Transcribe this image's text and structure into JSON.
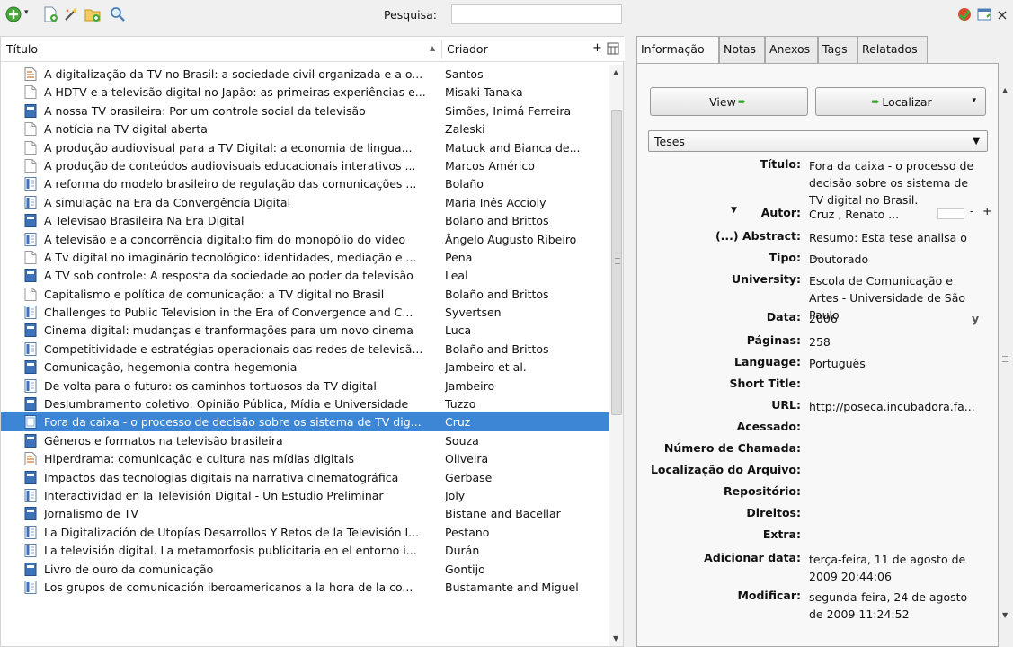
{
  "toolbar": {
    "search_label": "Pesquisa:",
    "search_value": ""
  },
  "columns": {
    "title": "Título",
    "creator": "Criador",
    "add_column": "+"
  },
  "items": [
    {
      "title": "A digitalização da TV no Brasil: a sociedade civil organizada e a o...",
      "creator": "Santos",
      "type": "document"
    },
    {
      "title": "A HDTV e a televisão digital no Japão: as primeiras experiências e...",
      "creator": "Misaki Tanaka",
      "type": "blank"
    },
    {
      "title": "A nossa TV brasileira: Por um controle social da televisão",
      "creator": "Simões, Inimá Ferreira",
      "type": "book"
    },
    {
      "title": "A notícia na TV digital aberta",
      "creator": "Zaleski",
      "type": "blank"
    },
    {
      "title": "A produção audiovisual para a TV Digital: a economia de lingua...",
      "creator": "Matuck and Bianca de...",
      "type": "blank"
    },
    {
      "title": "A produção de conteúdos audiovisuais educacionais interativos ...",
      "creator": "Marcos Américo",
      "type": "blank"
    },
    {
      "title": "A reforma do modelo brasileiro de regulação das comunicações ...",
      "creator": "Bolaño",
      "type": "journal"
    },
    {
      "title": "A simulação na Era da Convergência Digital",
      "creator": "Maria Inês Accioly",
      "type": "journal"
    },
    {
      "title": "A Televisao Brasileira Na Era Digital",
      "creator": "Bolano and Brittos",
      "type": "book"
    },
    {
      "title": "A televisão e a concorrência digital:o fim do monopólio do vídeo",
      "creator": "Ângelo Augusto Ribeiro",
      "type": "journal"
    },
    {
      "title": "A Tv digital no imaginário tecnológico: identidades, mediação e ...",
      "creator": "Pena",
      "type": "blank"
    },
    {
      "title": "A TV sob controle: A resposta da sociedade ao poder da televisão",
      "creator": "Leal",
      "type": "book"
    },
    {
      "title": "Capitalismo e política de comunicação: a TV digital no Brasil",
      "creator": "Bolaño and Brittos",
      "type": "blank"
    },
    {
      "title": "Challenges to Public Television in the Era of Convergence and C...",
      "creator": "Syvertsen",
      "type": "journal"
    },
    {
      "title": "Cinema digital: mudanças e tranformações para um novo cinema",
      "creator": "Luca",
      "type": "book"
    },
    {
      "title": "Competitividade e estratégias operacionais das redes de televisã...",
      "creator": "Bolaño and Brittos",
      "type": "journal"
    },
    {
      "title": "Comunicação, hegemonia  contra-hegemonia",
      "creator": "Jambeiro et al.",
      "type": "book"
    },
    {
      "title": "De volta para o futuro: os caminhos tortuosos da TV digital",
      "creator": "Jambeiro",
      "type": "journal"
    },
    {
      "title": "Deslumbramento coletivo: Opinião Pública, Mídia e Universidade",
      "creator": "Tuzzo",
      "type": "book"
    },
    {
      "title": "Fora da caixa - o processo de decisão sobre os sistema de TV dig...",
      "creator": "Cruz",
      "type": "thesis",
      "selected": true
    },
    {
      "title": "Gêneros e formatos na televisão brasileira",
      "creator": "Souza",
      "type": "book"
    },
    {
      "title": "Hiperdrama: comunicação e cultura nas mídias digitais",
      "creator": "Oliveira",
      "type": "document"
    },
    {
      "title": "Impactos das tecnologias digitais na narrativa cinematográfica",
      "creator": "Gerbase",
      "type": "book"
    },
    {
      "title": "Interactividad en la Televisión Digital - Un Estudio Preliminar",
      "creator": "Joly",
      "type": "journal"
    },
    {
      "title": "Jornalismo de TV",
      "creator": "Bistane and Bacellar",
      "type": "book"
    },
    {
      "title": "La Digitalización de Utopías Desarrollos Y Retos de la Televisión I...",
      "creator": "Pestano",
      "type": "journal"
    },
    {
      "title": "La televisión digital. La metamorfosis publicitaria en el entorno i...",
      "creator": "Durán",
      "type": "journal"
    },
    {
      "title": "Livro de ouro da comunicação",
      "creator": "Gontijo",
      "type": "book"
    },
    {
      "title": "Los grupos de comunicación iberoamericanos a la hora de la co...",
      "creator": "Bustamante and Miguel",
      "type": "journal"
    }
  ],
  "tabs": [
    "Informação",
    "Notas",
    "Anexos",
    "Tags",
    "Relatados"
  ],
  "actions": {
    "view": "View",
    "locate": "Localizar"
  },
  "item_type": "Teses",
  "fields": [
    {
      "label": "Título:",
      "value": "Fora da caixa - o processo de decisão sobre os sistema de TV digital no Brasil."
    },
    {
      "label": "Autor:",
      "value": "Cruz   ,  Renato ...",
      "author": true
    },
    {
      "label": "(...) Abstract:",
      "value": "Resumo: Esta tese analisa o ..."
    },
    {
      "label": "Tipo:",
      "value": "Doutorado"
    },
    {
      "label": "University:",
      "value": "Escola de Comunicação e Artes - Universidade de São Paulo"
    },
    {
      "label": "Data:",
      "value": "2006",
      "suffix": "y"
    },
    {
      "label": "Páginas:",
      "value": "258"
    },
    {
      "label": "Language:",
      "value": "Português"
    },
    {
      "label": "Short Title:",
      "value": ""
    },
    {
      "label": "URL:",
      "value": "http://poseca.incubadora.fa..."
    },
    {
      "label": "Acessado:",
      "value": ""
    },
    {
      "label": "Número de Chamada:",
      "value": ""
    },
    {
      "label": "Localização do Arquivo:",
      "value": ""
    },
    {
      "label": "Repositório:",
      "value": ""
    },
    {
      "label": "Direitos:",
      "value": ""
    },
    {
      "label": "Extra:",
      "value": ""
    },
    {
      "label": "Adicionar data:",
      "value": "terça-feira, 11 de agosto de 2009 20:44:06"
    },
    {
      "label": "Modificar:",
      "value": "segunda-feira, 24 de agosto de 2009 11:24:52"
    }
  ],
  "author_controls": {
    "minus": "-",
    "plus": "+"
  },
  "close_glyph": "×"
}
